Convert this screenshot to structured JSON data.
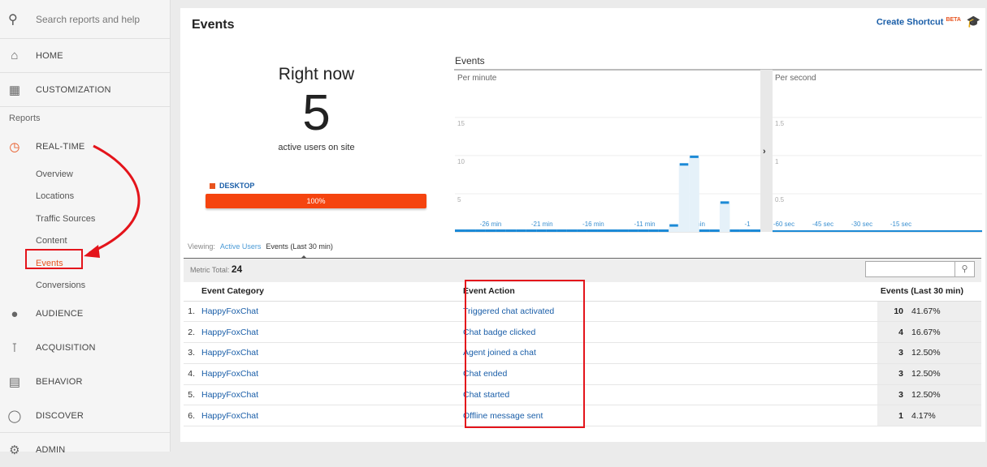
{
  "sidebar": {
    "search_placeholder": "Search reports and help",
    "home": "HOME",
    "customization": "CUSTOMIZATION",
    "reports": "Reports",
    "realtime": "REAL-TIME",
    "realtime_items": [
      "Overview",
      "Locations",
      "Traffic Sources",
      "Content",
      "Events",
      "Conversions"
    ],
    "audience": "AUDIENCE",
    "acquisition": "ACQUISITION",
    "behavior": "BEHAVIOR",
    "discover": "DISCOVER",
    "admin": "ADMIN"
  },
  "page": {
    "title": "Events",
    "shortcut": "Create Shortcut",
    "beta": "BETA"
  },
  "right_now": {
    "title": "Right now",
    "count": "5",
    "subtitle": "active users on site",
    "device": "DESKTOP",
    "device_pct": "100%",
    "device_fraction": 1.0
  },
  "chart_data": {
    "type": "bar",
    "title": "Events",
    "panels": [
      {
        "label": "Per minute",
        "yticks": [
          "15",
          "10",
          "5"
        ],
        "ylim": [
          0,
          17
        ],
        "xticks": [
          "-26 min",
          "-21 min",
          "-16 min",
          "-11 min",
          "-6 min",
          "-1"
        ],
        "x": [
          -30,
          -29,
          -28,
          -27,
          -26,
          -25,
          -24,
          -23,
          -22,
          -21,
          -20,
          -19,
          -18,
          -17,
          -16,
          -15,
          -14,
          -13,
          -12,
          -11,
          -10,
          -9,
          -8,
          -7,
          -6,
          -5,
          -4,
          -3,
          -2,
          -1
        ],
        "values": [
          0,
          0,
          0,
          0,
          0,
          0,
          0,
          0,
          0,
          0,
          0,
          0,
          0,
          0,
          0,
          0,
          0,
          0,
          0,
          0,
          0,
          1,
          9,
          10,
          0,
          0,
          4,
          0,
          0,
          0
        ]
      },
      {
        "label": "Per second",
        "yticks": [
          "1.5",
          "1",
          "0.5"
        ],
        "ylim": [
          0,
          1.7
        ],
        "xticks": [
          "-60 sec",
          "-45 sec",
          "-30 sec",
          "-15 sec"
        ],
        "values": []
      }
    ]
  },
  "viewing": {
    "label": "Viewing:",
    "tab1": "Active Users",
    "tab2": "Events (Last 30 min)"
  },
  "metric": {
    "label": "Metric Total:",
    "value": "24"
  },
  "table": {
    "headers": [
      "Event Category",
      "Event Action",
      "Events (Last 30 min)"
    ],
    "rows": [
      {
        "i": "1.",
        "cat": "HappyFoxChat",
        "act": "Triggered chat activated",
        "n": "10",
        "p": "41.67%"
      },
      {
        "i": "2.",
        "cat": "HappyFoxChat",
        "act": "Chat badge clicked",
        "n": "4",
        "p": "16.67%"
      },
      {
        "i": "3.",
        "cat": "HappyFoxChat",
        "act": "Agent joined a chat",
        "n": "3",
        "p": "12.50%"
      },
      {
        "i": "4.",
        "cat": "HappyFoxChat",
        "act": "Chat ended",
        "n": "3",
        "p": "12.50%"
      },
      {
        "i": "5.",
        "cat": "HappyFoxChat",
        "act": "Chat started",
        "n": "3",
        "p": "12.50%"
      },
      {
        "i": "6.",
        "cat": "HappyFoxChat",
        "act": "Offline message sent",
        "n": "1",
        "p": "4.17%"
      }
    ]
  }
}
